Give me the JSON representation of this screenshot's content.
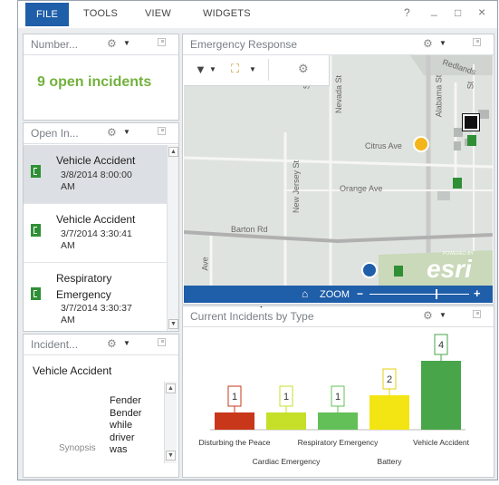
{
  "menu": {
    "file": "FILE",
    "tools": "TOOLS",
    "view": "VIEW",
    "widgets": "WIDGETS",
    "help": "?",
    "minimize": "_",
    "maximize": "□",
    "close": "×"
  },
  "number_panel": {
    "title": "Number...",
    "summary": "9 open incidents"
  },
  "open_incidents_panel": {
    "title": "Open In...",
    "items": [
      {
        "type": "Vehicle Accident",
        "date_line1": "3/8/2014 8:00:00",
        "date_line2": "AM",
        "selected": true
      },
      {
        "type": "Vehicle Accident",
        "date_line1": "3/7/2014 3:30:41",
        "date_line2": "AM",
        "selected": false
      },
      {
        "type_line1": "Respiratory",
        "type_line2": "Emergency",
        "date_line1": "3/7/2014 3:30:37",
        "date_line2": "AM",
        "selected": false
      }
    ]
  },
  "incident_detail_panel": {
    "title": "Incident...",
    "heading": "Vehicle Accident",
    "field_label": "Synopsis",
    "synopsis_lines": [
      "Fender",
      "Bender",
      "while",
      "driver",
      "was"
    ]
  },
  "map_panel": {
    "title": "Emergency Response",
    "zoom_label": "ZOOM",
    "zoom_minus": "−",
    "zoom_plus": "+",
    "home_icon": "home-icon",
    "esri_logo": "esri",
    "powered_by": "POWERED BY",
    "roads": {
      "nevada": "Nevada St",
      "new_jersey": "New Jersey St",
      "alabama": "Alabama St",
      "citrus": "Citrus Ave",
      "orange": "Orange Ave",
      "barton": "Barton Rd",
      "redlands": "Redlands",
      "ave": "Ave",
      "st": "St",
      "st2": "St"
    }
  },
  "chart_panel": {
    "title": "Current Incidents by Type"
  },
  "chart_data": {
    "type": "bar",
    "categories": [
      "Disturbing the Peace",
      "Cardiac Emergency",
      "Respiratory Emergency",
      "Battery",
      "Vehicle Accident"
    ],
    "values": [
      1,
      1,
      1,
      2,
      4
    ],
    "colors": [
      "#c8371a",
      "#c6e02a",
      "#63c058",
      "#f3e513",
      "#49a54a"
    ],
    "label_colors": [
      "#c8371a",
      "#c6e02a",
      "#63c058",
      "#e6cf10",
      "#49a54a"
    ],
    "ylim": [
      0,
      4
    ],
    "title": "",
    "xlabel": "",
    "ylabel": ""
  }
}
